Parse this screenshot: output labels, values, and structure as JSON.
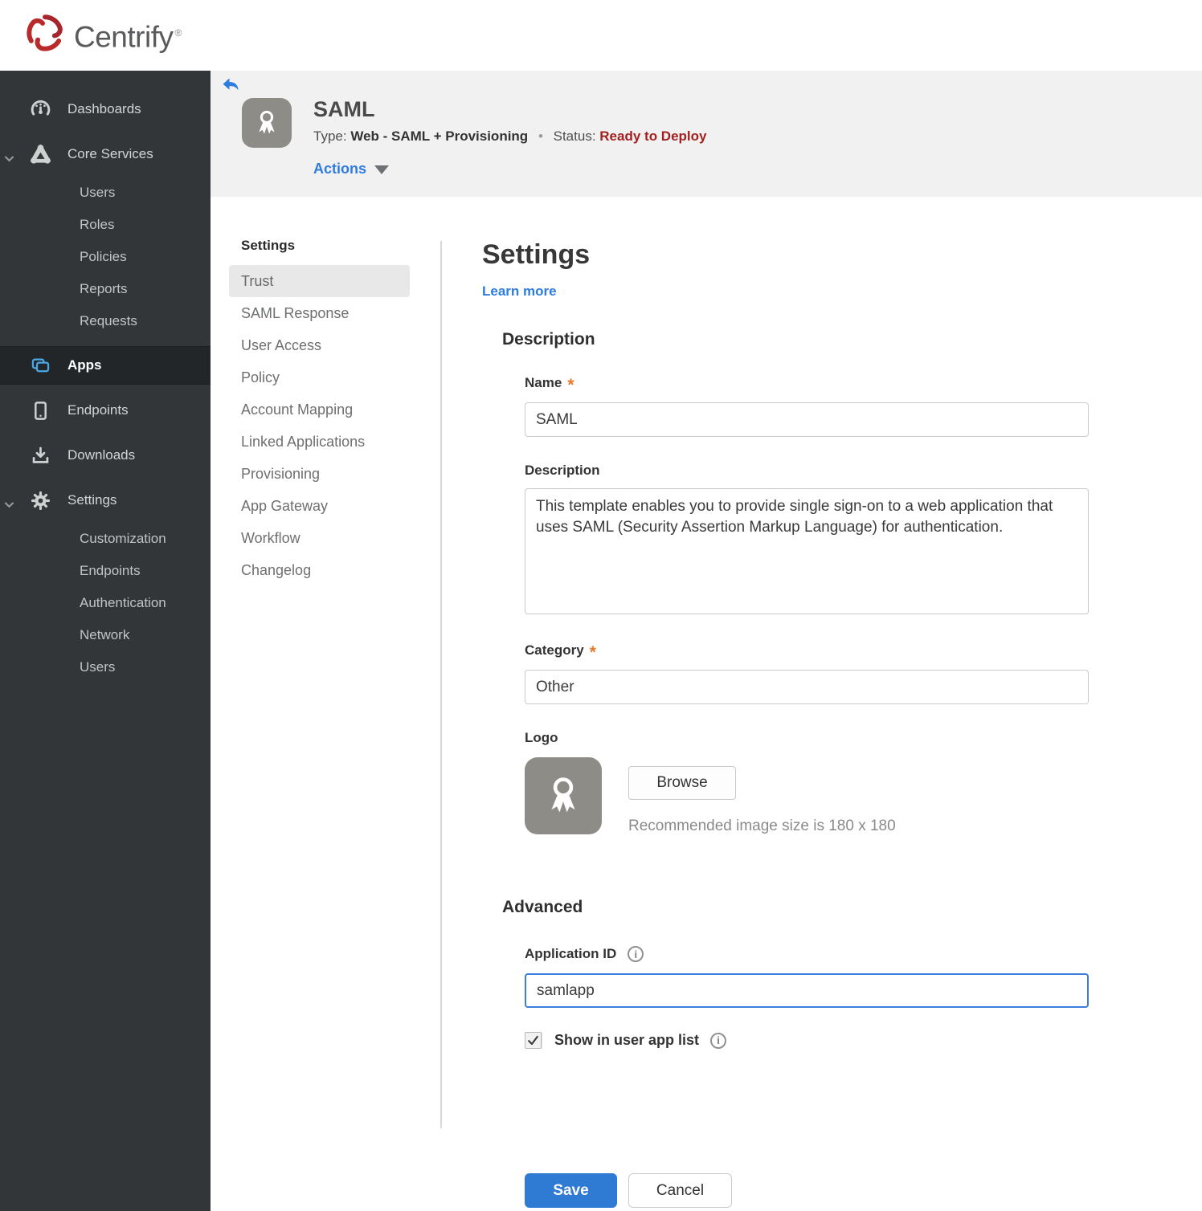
{
  "brand": {
    "name": "Centrify",
    "reg_mark": "®"
  },
  "colors": {
    "brand_red": "#b92b2b",
    "sidebar_bg": "#333639",
    "sidebar_active_bg": "#232628",
    "apps_icon_blue": "#49a8e6",
    "header_bg": "#f1f1f2",
    "link_blue": "#2d7ce0",
    "status_red": "#a32020",
    "save_blue": "#2f7bd4",
    "required_orange": "#e87a2b",
    "focus_border": "#3c7edb"
  },
  "sidebar": {
    "items": [
      {
        "label": "Dashboards",
        "icon": "gauge-icon"
      },
      {
        "label": "Core Services",
        "icon": "core-services-icon",
        "expanded": true,
        "children": [
          "Users",
          "Roles",
          "Policies",
          "Reports",
          "Requests"
        ]
      },
      {
        "label": "Apps",
        "icon": "apps-icon",
        "active": true
      },
      {
        "label": "Endpoints",
        "icon": "tablet-icon"
      },
      {
        "label": "Downloads",
        "icon": "download-icon"
      },
      {
        "label": "Settings",
        "icon": "gear-icon",
        "expanded": true,
        "children": [
          "Customization",
          "Endpoints",
          "Authentication",
          "Network",
          "Users"
        ]
      }
    ]
  },
  "app_header": {
    "title": "SAML",
    "type_label": "Type:",
    "type_value": "Web - SAML + Provisioning",
    "separator": "•",
    "status_label": "Status:",
    "status_value": "Ready to Deploy",
    "actions_label": "Actions"
  },
  "subnav": {
    "header": "Settings",
    "selected": "Trust",
    "items": [
      "Trust",
      "SAML Response",
      "User Access",
      "Policy",
      "Account Mapping",
      "Linked Applications",
      "Provisioning",
      "App Gateway",
      "Workflow",
      "Changelog"
    ]
  },
  "form": {
    "title": "Settings",
    "learn_more_label": "Learn more",
    "description_section": "Description",
    "name_label": "Name",
    "name_value": "SAML",
    "desc_label": "Description",
    "desc_value": "This template enables you to provide single sign-on to a web application that uses SAML (Security Assertion Markup Language) for authentication.",
    "category_label": "Category",
    "category_value": "Other",
    "logo_label": "Logo",
    "browse_label": "Browse",
    "logo_hint": "Recommended image size is 180 x 180",
    "advanced_section": "Advanced",
    "app_id_label": "Application ID",
    "app_id_value": "samlapp",
    "show_in_list_label": "Show in user app list",
    "checkbox_checked": true,
    "save_label": "Save",
    "cancel_label": "Cancel"
  }
}
